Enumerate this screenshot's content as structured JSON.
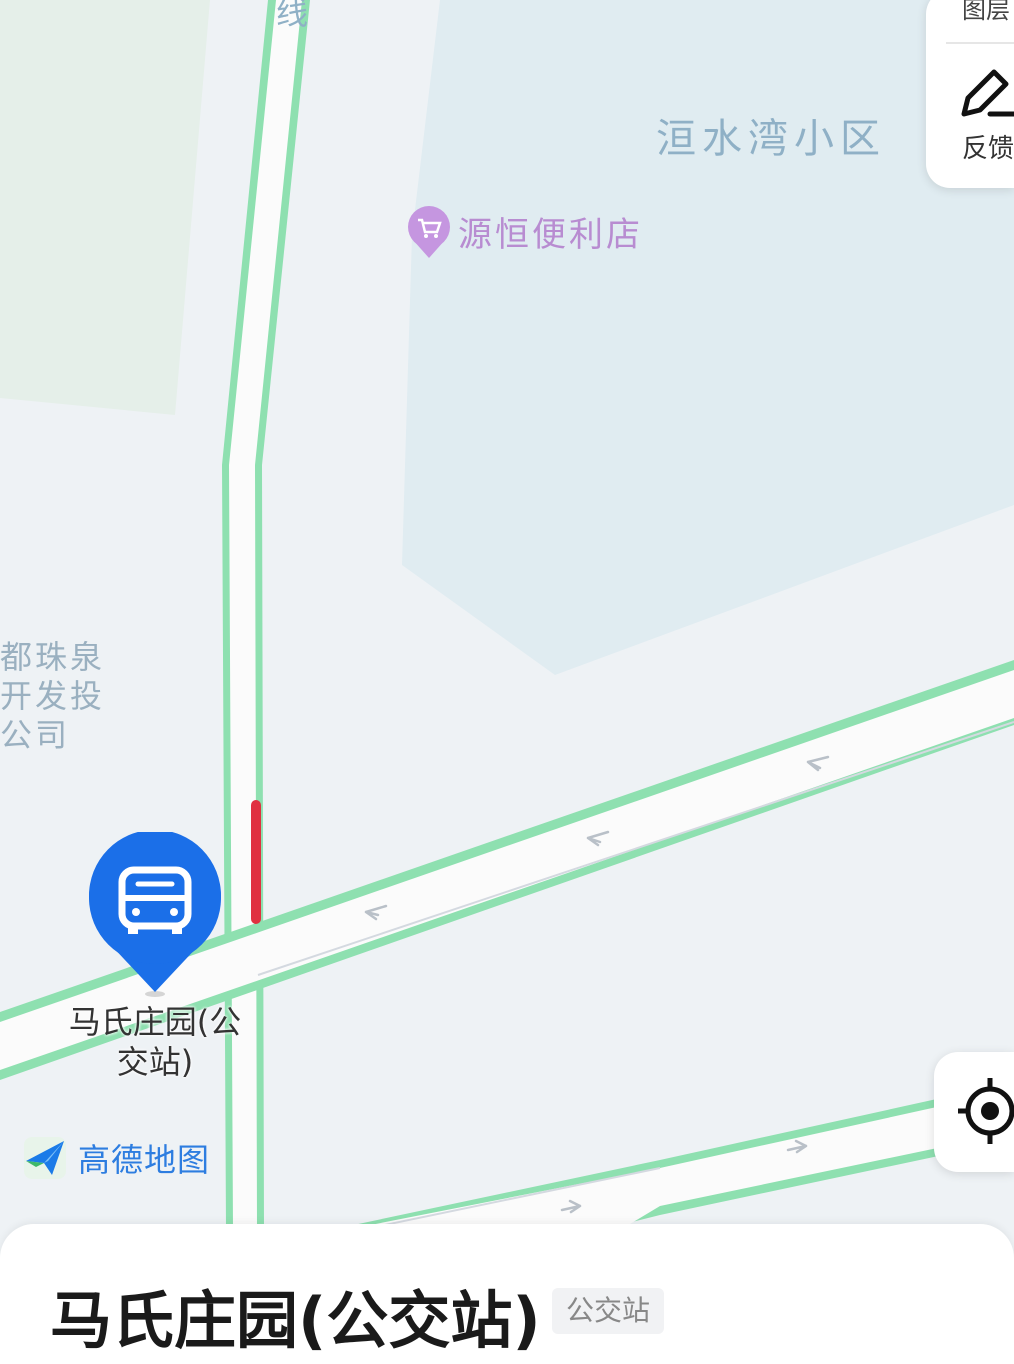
{
  "map": {
    "road_label_top": "线",
    "district_label": "洹水湾小区",
    "poi": {
      "name": "源恒便利店",
      "icon": "shopping-cart-icon",
      "color": "#c596e0"
    },
    "left_labels": [
      "都珠泉",
      "开发投",
      "公司"
    ],
    "bus_stop_label_line1": "马氏庄园(公",
    "bus_stop_label_line2": "交站)",
    "bus_pin_color": "#1b6fe8",
    "road_border_color": "#8ee0b0",
    "traffic_segment_color": "#e03040"
  },
  "side_panel": {
    "layers_label": "图层",
    "feedback_label": "反馈",
    "feedback_icon": "pencil-icon"
  },
  "locate_button": {
    "icon": "locate-crosshair-icon"
  },
  "logo": {
    "text": "高德地图",
    "icon": "amap-paper-plane-icon"
  },
  "bottom_sheet": {
    "title": "马氏庄园(公交站)",
    "tag": "公交站"
  }
}
